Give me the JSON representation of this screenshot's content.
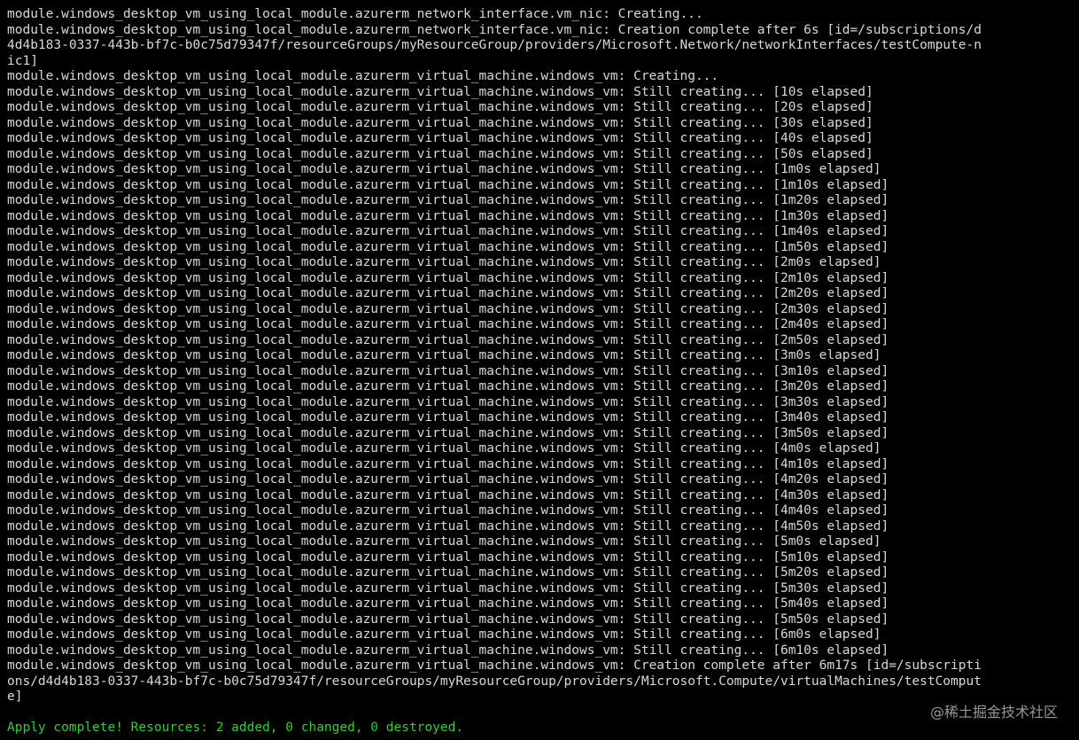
{
  "terminal": {
    "colors": {
      "background": "#000000",
      "foreground": "#d8d8d8",
      "success": "#2fd02f"
    },
    "lines": [
      {
        "kind": "normal",
        "text": "module.windows_desktop_vm_using_local_module.azurerm_network_interface.vm_nic: Creating..."
      },
      {
        "kind": "normal",
        "text": "module.windows_desktop_vm_using_local_module.azurerm_network_interface.vm_nic: Creation complete after 6s [id=/subscriptions/d"
      },
      {
        "kind": "normal",
        "text": "4d4b183-0337-443b-bf7c-b0c75d79347f/resourceGroups/myResourceGroup/providers/Microsoft.Network/networkInterfaces/testCompute-n"
      },
      {
        "kind": "normal",
        "text": "ic1]"
      },
      {
        "kind": "normal",
        "text": "module.windows_desktop_vm_using_local_module.azurerm_virtual_machine.windows_vm: Creating..."
      },
      {
        "kind": "normal",
        "text": "module.windows_desktop_vm_using_local_module.azurerm_virtual_machine.windows_vm: Still creating... [10s elapsed]"
      },
      {
        "kind": "normal",
        "text": "module.windows_desktop_vm_using_local_module.azurerm_virtual_machine.windows_vm: Still creating... [20s elapsed]"
      },
      {
        "kind": "normal",
        "text": "module.windows_desktop_vm_using_local_module.azurerm_virtual_machine.windows_vm: Still creating... [30s elapsed]"
      },
      {
        "kind": "normal",
        "text": "module.windows_desktop_vm_using_local_module.azurerm_virtual_machine.windows_vm: Still creating... [40s elapsed]"
      },
      {
        "kind": "normal",
        "text": "module.windows_desktop_vm_using_local_module.azurerm_virtual_machine.windows_vm: Still creating... [50s elapsed]"
      },
      {
        "kind": "normal",
        "text": "module.windows_desktop_vm_using_local_module.azurerm_virtual_machine.windows_vm: Still creating... [1m0s elapsed]"
      },
      {
        "kind": "normal",
        "text": "module.windows_desktop_vm_using_local_module.azurerm_virtual_machine.windows_vm: Still creating... [1m10s elapsed]"
      },
      {
        "kind": "normal",
        "text": "module.windows_desktop_vm_using_local_module.azurerm_virtual_machine.windows_vm: Still creating... [1m20s elapsed]"
      },
      {
        "kind": "normal",
        "text": "module.windows_desktop_vm_using_local_module.azurerm_virtual_machine.windows_vm: Still creating... [1m30s elapsed]"
      },
      {
        "kind": "normal",
        "text": "module.windows_desktop_vm_using_local_module.azurerm_virtual_machine.windows_vm: Still creating... [1m40s elapsed]"
      },
      {
        "kind": "normal",
        "text": "module.windows_desktop_vm_using_local_module.azurerm_virtual_machine.windows_vm: Still creating... [1m50s elapsed]"
      },
      {
        "kind": "normal",
        "text": "module.windows_desktop_vm_using_local_module.azurerm_virtual_machine.windows_vm: Still creating... [2m0s elapsed]"
      },
      {
        "kind": "normal",
        "text": "module.windows_desktop_vm_using_local_module.azurerm_virtual_machine.windows_vm: Still creating... [2m10s elapsed]"
      },
      {
        "kind": "normal",
        "text": "module.windows_desktop_vm_using_local_module.azurerm_virtual_machine.windows_vm: Still creating... [2m20s elapsed]"
      },
      {
        "kind": "normal",
        "text": "module.windows_desktop_vm_using_local_module.azurerm_virtual_machine.windows_vm: Still creating... [2m30s elapsed]"
      },
      {
        "kind": "normal",
        "text": "module.windows_desktop_vm_using_local_module.azurerm_virtual_machine.windows_vm: Still creating... [2m40s elapsed]"
      },
      {
        "kind": "normal",
        "text": "module.windows_desktop_vm_using_local_module.azurerm_virtual_machine.windows_vm: Still creating... [2m50s elapsed]"
      },
      {
        "kind": "normal",
        "text": "module.windows_desktop_vm_using_local_module.azurerm_virtual_machine.windows_vm: Still creating... [3m0s elapsed]"
      },
      {
        "kind": "normal",
        "text": "module.windows_desktop_vm_using_local_module.azurerm_virtual_machine.windows_vm: Still creating... [3m10s elapsed]"
      },
      {
        "kind": "normal",
        "text": "module.windows_desktop_vm_using_local_module.azurerm_virtual_machine.windows_vm: Still creating... [3m20s elapsed]"
      },
      {
        "kind": "normal",
        "text": "module.windows_desktop_vm_using_local_module.azurerm_virtual_machine.windows_vm: Still creating... [3m30s elapsed]"
      },
      {
        "kind": "normal",
        "text": "module.windows_desktop_vm_using_local_module.azurerm_virtual_machine.windows_vm: Still creating... [3m40s elapsed]"
      },
      {
        "kind": "normal",
        "text": "module.windows_desktop_vm_using_local_module.azurerm_virtual_machine.windows_vm: Still creating... [3m50s elapsed]"
      },
      {
        "kind": "normal",
        "text": "module.windows_desktop_vm_using_local_module.azurerm_virtual_machine.windows_vm: Still creating... [4m0s elapsed]"
      },
      {
        "kind": "normal",
        "text": "module.windows_desktop_vm_using_local_module.azurerm_virtual_machine.windows_vm: Still creating... [4m10s elapsed]"
      },
      {
        "kind": "normal",
        "text": "module.windows_desktop_vm_using_local_module.azurerm_virtual_machine.windows_vm: Still creating... [4m20s elapsed]"
      },
      {
        "kind": "normal",
        "text": "module.windows_desktop_vm_using_local_module.azurerm_virtual_machine.windows_vm: Still creating... [4m30s elapsed]"
      },
      {
        "kind": "normal",
        "text": "module.windows_desktop_vm_using_local_module.azurerm_virtual_machine.windows_vm: Still creating... [4m40s elapsed]"
      },
      {
        "kind": "normal",
        "text": "module.windows_desktop_vm_using_local_module.azurerm_virtual_machine.windows_vm: Still creating... [4m50s elapsed]"
      },
      {
        "kind": "normal",
        "text": "module.windows_desktop_vm_using_local_module.azurerm_virtual_machine.windows_vm: Still creating... [5m0s elapsed]"
      },
      {
        "kind": "normal",
        "text": "module.windows_desktop_vm_using_local_module.azurerm_virtual_machine.windows_vm: Still creating... [5m10s elapsed]"
      },
      {
        "kind": "normal",
        "text": "module.windows_desktop_vm_using_local_module.azurerm_virtual_machine.windows_vm: Still creating... [5m20s elapsed]"
      },
      {
        "kind": "normal",
        "text": "module.windows_desktop_vm_using_local_module.azurerm_virtual_machine.windows_vm: Still creating... [5m30s elapsed]"
      },
      {
        "kind": "normal",
        "text": "module.windows_desktop_vm_using_local_module.azurerm_virtual_machine.windows_vm: Still creating... [5m40s elapsed]"
      },
      {
        "kind": "normal",
        "text": "module.windows_desktop_vm_using_local_module.azurerm_virtual_machine.windows_vm: Still creating... [5m50s elapsed]"
      },
      {
        "kind": "normal",
        "text": "module.windows_desktop_vm_using_local_module.azurerm_virtual_machine.windows_vm: Still creating... [6m0s elapsed]"
      },
      {
        "kind": "normal",
        "text": "module.windows_desktop_vm_using_local_module.azurerm_virtual_machine.windows_vm: Still creating... [6m10s elapsed]"
      },
      {
        "kind": "normal",
        "text": "module.windows_desktop_vm_using_local_module.azurerm_virtual_machine.windows_vm: Creation complete after 6m17s [id=/subscripti"
      },
      {
        "kind": "normal",
        "text": "ons/d4d4b183-0337-443b-bf7c-b0c75d79347f/resourceGroups/myResourceGroup/providers/Microsoft.Compute/virtualMachines/testComput"
      },
      {
        "kind": "normal",
        "text": "e]"
      },
      {
        "kind": "blank",
        "text": ""
      },
      {
        "kind": "success",
        "text": "Apply complete! Resources: 2 added, 0 changed, 0 destroyed."
      }
    ]
  },
  "watermark": {
    "text": "@稀土掘金技术社区"
  }
}
